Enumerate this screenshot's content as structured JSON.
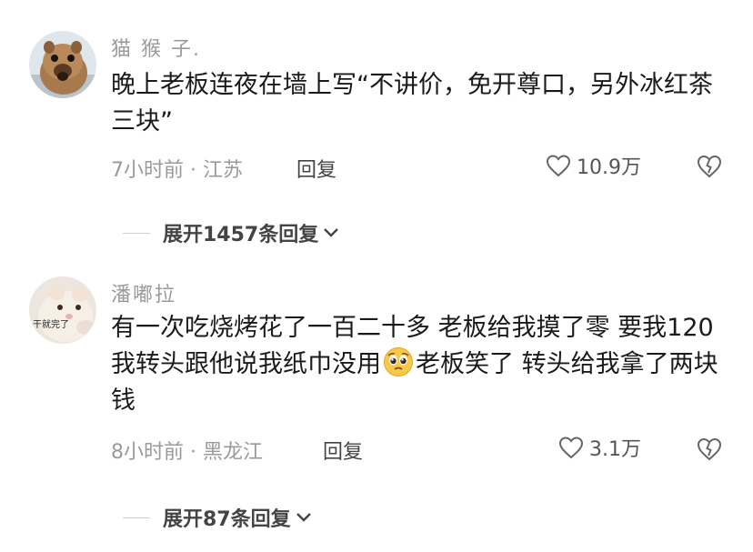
{
  "comments": [
    {
      "username": "猫 猴 子.",
      "text": "晚上老板连夜在墙上写“不讲价，免开尊口，另外冰红茶三块”",
      "time_location": "7小时前 · 江苏",
      "reply_label": "回复",
      "likes": "10.9万",
      "expand_label": "展开1457条回复"
    },
    {
      "username": "潘嘟拉",
      "avatar_text": "干就完了",
      "text_before_emoji": "有一次吃烧烤花了一百二十多 老板给我摸了零 要我120 我转头跟他说我纸巾没用",
      "emoji": "pleading-face-emoji",
      "text_after_emoji": "老板笑了 转头给我拿了两块钱",
      "time_location": "8小时前 · 黑龙江",
      "reply_label": "回复",
      "likes": "3.1万",
      "expand_label": "展开87条回复"
    }
  ],
  "icons": {
    "like": "heart-outline-icon",
    "dislike": "broken-heart-icon",
    "expand": "chevron-down-icon"
  },
  "colors": {
    "meta_gray": "#9a9a9a",
    "text": "#1a1a1a"
  }
}
